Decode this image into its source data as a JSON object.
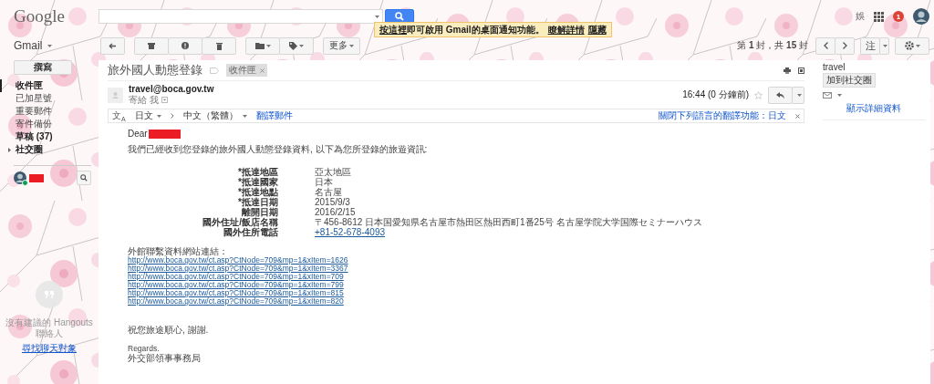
{
  "header": {
    "logo": "Google",
    "account_letter": "娛",
    "notification_count": "1"
  },
  "notice": [
    {
      "text": "按這裡",
      "link": true
    },
    {
      "text": "即可啟用 Gmail的桌面通知功能。",
      "link": false
    },
    {
      "text": "瞭解詳情",
      "link": true
    },
    {
      "text": "隱藏",
      "link": true
    }
  ],
  "toolbar": {
    "app_menu": "Gmail",
    "more": "更多",
    "paging": "第 **1** 封，共 **15** 封",
    "input_tool": "注"
  },
  "sidebar": {
    "compose": "撰寫",
    "items": [
      {
        "label": "收件匣",
        "selected": true,
        "unread": true,
        "expandable": false
      },
      {
        "label": "已加星號",
        "selected": false,
        "unread": false,
        "expandable": false
      },
      {
        "label": "重要郵件",
        "selected": false,
        "unread": false,
        "expandable": false
      },
      {
        "label": "寄件備份",
        "selected": false,
        "unread": false,
        "expandable": false
      },
      {
        "label": "草稿 (37)",
        "selected": false,
        "unread": true,
        "expandable": false
      },
      {
        "label": "社交圈",
        "selected": false,
        "unread": true,
        "expandable": true
      }
    ],
    "chat": {
      "online": true,
      "empty_text": "沒有建議的 Hangouts 聯絡人",
      "find_link": "尋找聊天對象"
    }
  },
  "message": {
    "subject": "旅外國人動態登錄",
    "labels": [
      "收件匣"
    ],
    "sender": "travel@boca.gov.tw",
    "recipient": "寄給 我",
    "time": "16:44 (0 分鐘前)",
    "starred": false,
    "translate": {
      "icon": "文$_{A}$",
      "from": "日文",
      "to": "中文（繁體）",
      "action": "翻譯郵件",
      "turn_off": "關閉下列語言的翻譯功能：日文"
    },
    "body": {
      "greeting": "Dear",
      "intro": "我們已經收到您登錄的旅外國人動態登錄資料, 以下為您所登錄的旅遊資訊:",
      "details": [
        {
          "label": "*抵達地區",
          "value": "亞太地區",
          "kind": "text"
        },
        {
          "label": "*抵達國家",
          "value": "日本",
          "kind": "text"
        },
        {
          "label": "*抵達地點",
          "value": "名古屋",
          "kind": "text"
        },
        {
          "label": "*抵達日期",
          "value": "2015/9/3",
          "kind": "text"
        },
        {
          "label": "離開日期",
          "value": "2016/2/15",
          "kind": "text"
        },
        {
          "label": "國外住址/飯店名稱",
          "value": "〒456-8612 日本国愛知県名古屋市熱田区熱田西町1番25号 名古屋学院大学国際セミナーハウス",
          "kind": "text"
        },
        {
          "label": "國外住所電話",
          "value": "+81-52-678-4093",
          "kind": "link"
        }
      ],
      "links_heading": "外館聯繫資料網站連結：",
      "links": [
        "http://www.boca.gov.tw/ct.asp?CtNode=709&mp=1&xItem=1626",
        "http://www.boca.gov.tw/ct.asp?CtNode=709&mp=1&xItem=3367",
        "http://www.boca.gov.tw/ct.asp?CtNode=709&mp=1&xItem=709",
        "http://www.boca.gov.tw/ct.asp?CtNode=709&mp=1&xItem=799",
        "http://www.boca.gov.tw/ct.asp?CtNode=709&mp=1&xItem=815",
        "http://www.boca.gov.tw/ct.asp?CtNode=709&mp=1&xItem=820"
      ],
      "wish": "祝您旅途順心, 謝謝.",
      "regards": "Regards.",
      "signature": "外交部領事事務局"
    }
  },
  "contact": {
    "name": "travel",
    "add_button": "加到社交圈",
    "details_link": "顯示詳細資料"
  }
}
